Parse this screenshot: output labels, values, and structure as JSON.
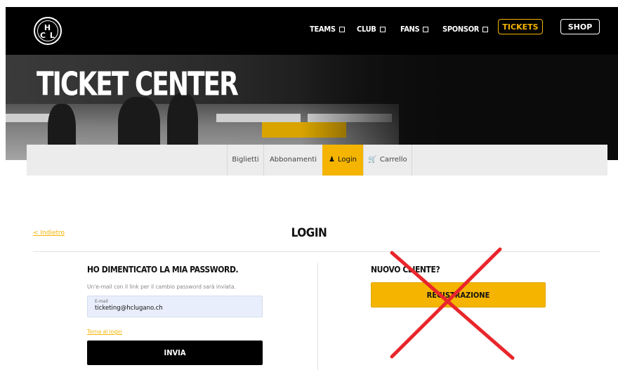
{
  "nav": {
    "logo_text": "H C L LUGANO",
    "items": [
      {
        "label": "TEAMS"
      },
      {
        "label": "CLUB"
      },
      {
        "label": "FANS"
      },
      {
        "label": "SPONSOR"
      }
    ],
    "tickets_label": "TICKETS",
    "shop_label": "SHOP",
    "accent": "#f4b400"
  },
  "hero": {
    "title": "TICKET CENTER"
  },
  "tabs": [
    {
      "label": "Biglietti",
      "active": false
    },
    {
      "label": "Abbonamenti",
      "active": false
    },
    {
      "label": "Login",
      "active": true,
      "icon": "user-icon"
    },
    {
      "label": "Carrello",
      "active": false,
      "icon": "cart-icon"
    }
  ],
  "main": {
    "back_label": "Indietro",
    "page_title": "LOGIN",
    "forgot": {
      "heading": "HO DIMENTICATO LA MIA PASSWORD.",
      "hint": "Un'e-mail con il link per il cambio password sarà inviata.",
      "email_label": "E-mail",
      "email_value": "ticketing@hclugano.ch",
      "back_to_login": "Torna al login",
      "submit_label": "INVIA"
    },
    "new_client": {
      "heading": "NUOVO CLIENTE?",
      "register_label": "REGISTRAZIONE",
      "overlay": "red-cross-icon"
    }
  }
}
